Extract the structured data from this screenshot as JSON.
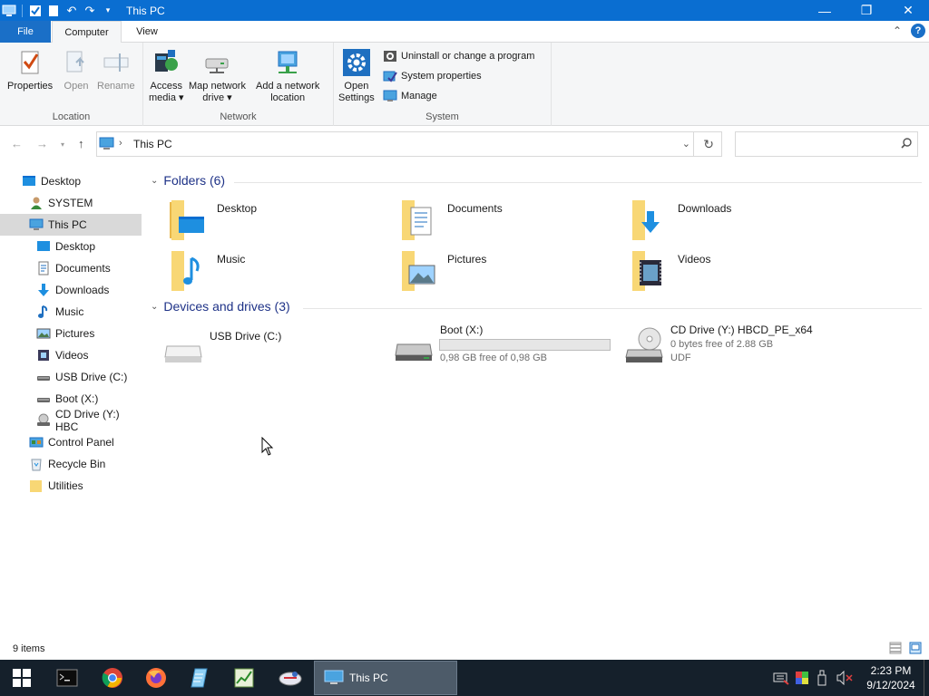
{
  "window": {
    "title": "This PC",
    "controls": {
      "minimize": "—",
      "restore": "❐",
      "close": "✕"
    }
  },
  "ribbon_tabs": [
    {
      "label": "File"
    },
    {
      "label": "Computer"
    },
    {
      "label": "View"
    }
  ],
  "ribbon": {
    "location": {
      "group_label": "Location",
      "properties": "Properties",
      "open": "Open",
      "rename": "Rename"
    },
    "network": {
      "group_label": "Network",
      "access_media_1": "Access",
      "access_media_2": "media ▾",
      "map_drive_1": "Map network",
      "map_drive_2": "drive ▾",
      "add_location_1": "Add a network",
      "add_location_2": "location"
    },
    "system": {
      "group_label": "System",
      "open_settings_1": "Open",
      "open_settings_2": "Settings",
      "uninstall": "Uninstall or change a program",
      "system_properties": "System properties",
      "manage": "Manage"
    }
  },
  "address": {
    "crumb": "This PC",
    "search_placeholder": ""
  },
  "nav_pane": [
    {
      "label": "Desktop",
      "icon": "desktop-icon"
    },
    {
      "label": "SYSTEM",
      "icon": "user-icon"
    },
    {
      "label": "This PC",
      "icon": "pc-icon",
      "selected": true
    },
    {
      "label": "Desktop",
      "icon": "desktop-icon"
    },
    {
      "label": "Documents",
      "icon": "documents-icon"
    },
    {
      "label": "Downloads",
      "icon": "downloads-icon"
    },
    {
      "label": "Music",
      "icon": "music-icon"
    },
    {
      "label": "Pictures",
      "icon": "pictures-icon"
    },
    {
      "label": "Videos",
      "icon": "videos-icon"
    },
    {
      "label": "USB Drive (C:)",
      "icon": "drive-icon"
    },
    {
      "label": "Boot (X:)",
      "icon": "drive-icon"
    },
    {
      "label": "CD Drive (Y:) HBC",
      "icon": "cd-drive-icon"
    },
    {
      "label": "Control Panel",
      "icon": "control-panel-icon"
    },
    {
      "label": "Recycle Bin",
      "icon": "recycle-bin-icon"
    },
    {
      "label": "Utilities",
      "icon": "folder-icon"
    }
  ],
  "folders": {
    "heading": "Folders (6)",
    "items": [
      {
        "name": "Desktop"
      },
      {
        "name": "Documents"
      },
      {
        "name": "Downloads"
      },
      {
        "name": "Music"
      },
      {
        "name": "Pictures"
      },
      {
        "name": "Videos"
      }
    ]
  },
  "drives": {
    "heading": "Devices and drives (3)",
    "items": [
      {
        "name": "USB Drive (C:)"
      },
      {
        "name": "Boot (X:)",
        "free_text": "0,98 GB free of 0,98 GB",
        "used_fraction": 0.0
      },
      {
        "name": "CD Drive (Y:) HBCD_PE_x64",
        "free_text": "0 bytes free of 2.88 GB",
        "fs": "UDF"
      }
    ]
  },
  "status": {
    "items": "9 items"
  },
  "taskbar": {
    "active_window": "This PC",
    "time": "2:23 PM",
    "date": "9/12/2024"
  },
  "colors": {
    "titlebar": "#0a6ed1",
    "accent": "#1a6fc7",
    "taskbar": "#15202b"
  }
}
